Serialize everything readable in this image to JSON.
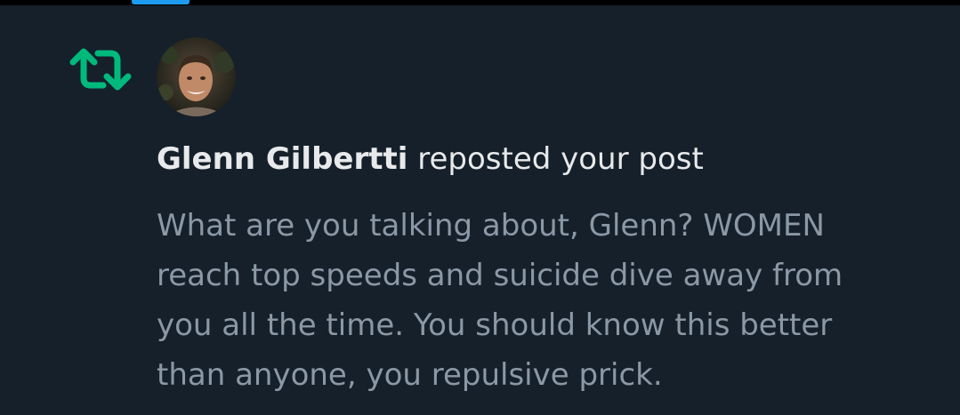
{
  "notification": {
    "icon": "repost-icon",
    "accent_color": "#00ba7c",
    "avatar": "avatar",
    "user_name": "Glenn Gilbertti",
    "action_text": "reposted your post",
    "post_lines": [
      "What are you talking about, Glenn? WOMEN",
      "reach top speeds and suicide dive away from",
      "you all the time. You should know this better",
      "than anyone, you repulsive prick."
    ]
  }
}
